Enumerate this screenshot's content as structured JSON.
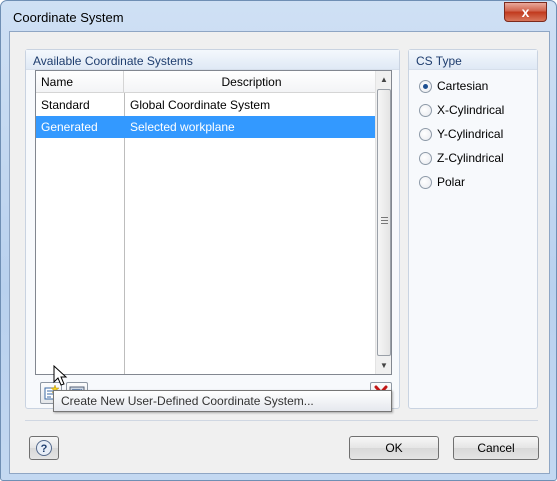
{
  "window": {
    "title": "Coordinate System",
    "close_glyph": "x"
  },
  "available": {
    "header": "Available Coordinate Systems",
    "columns": {
      "name": "Name",
      "description": "Description"
    },
    "rows": [
      {
        "name": "Standard",
        "description": "Global Coordinate System",
        "selected": false
      },
      {
        "name": "Generated",
        "description": "Selected workplane",
        "selected": true
      }
    ],
    "toolbar": {
      "new_icon": "new-cs-icon",
      "edit_icon": "edit-cs-icon",
      "delete_icon": "delete-icon"
    }
  },
  "cs_type": {
    "header": "CS Type",
    "options": [
      "Cartesian",
      "X-Cylindrical",
      "Y-Cylindrical",
      "Z-Cylindrical",
      "Polar"
    ],
    "selected": "Cartesian"
  },
  "tooltip": "Create New User-Defined Coordinate System...",
  "buttons": {
    "help_icon": "help-icon",
    "ok": "OK",
    "cancel": "Cancel"
  }
}
